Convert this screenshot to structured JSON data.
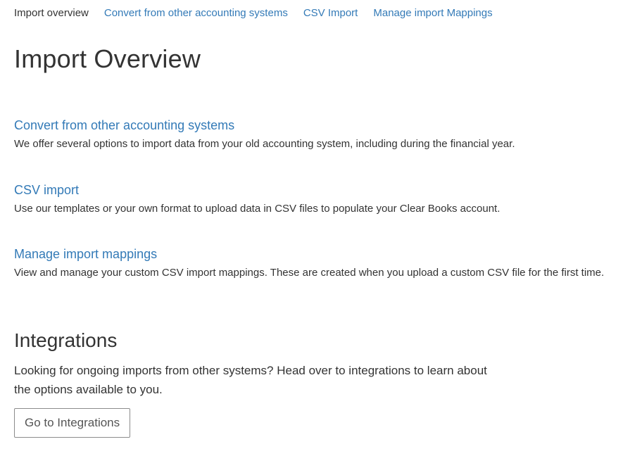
{
  "tabs": [
    {
      "label": "Import overview",
      "active": true
    },
    {
      "label": "Convert from other accounting systems",
      "active": false
    },
    {
      "label": "CSV Import",
      "active": false
    },
    {
      "label": "Manage import Mappings",
      "active": false
    }
  ],
  "page_title": "Import Overview",
  "sections": [
    {
      "link": "Convert from other accounting systems",
      "description": "We offer several options to import data from your old accounting system, including during the financial year."
    },
    {
      "link": "CSV import",
      "description": "Use our templates or your own format to upload data in CSV files to populate your Clear Books account."
    },
    {
      "link": "Manage import mappings",
      "description": "View and manage your custom CSV import mappings. These are created when you upload a custom CSV file for the first time."
    }
  ],
  "integrations": {
    "title": "Integrations",
    "text": "Looking for ongoing imports from other systems? Head over to integrations to learn about the options available to you.",
    "button_label": "Go to Integrations"
  },
  "colors": {
    "link": "#337ab7",
    "text": "#333333",
    "button_border": "#8c8c8c"
  }
}
